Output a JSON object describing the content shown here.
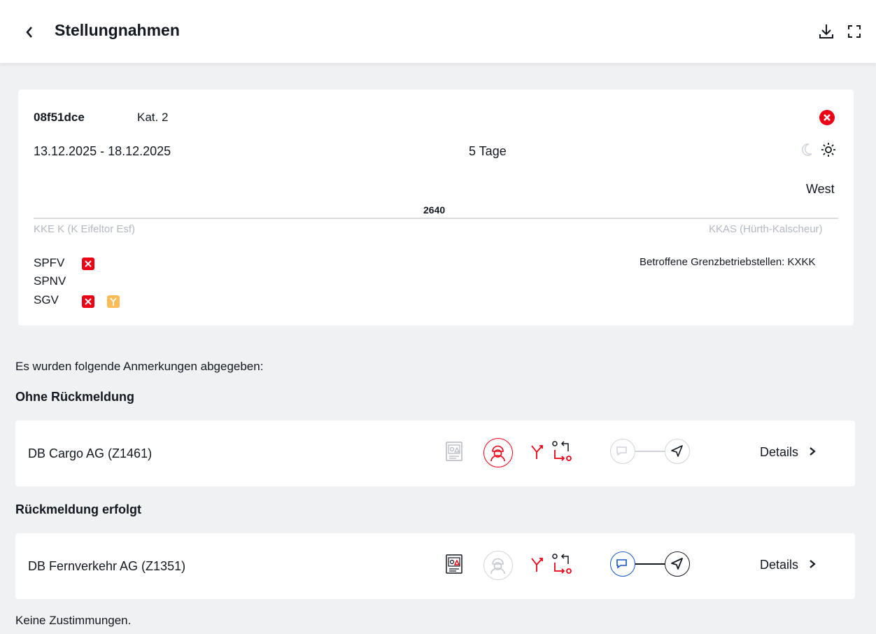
{
  "header": {
    "title": "Stellungnahmen",
    "back_icon": "chevron-left-icon",
    "download_icon": "download-icon",
    "fullscreen_icon": "fullscreen-icon"
  },
  "measure": {
    "id": "08f51dce",
    "category": "Kat. 2",
    "date_range": "13.12.2025 - 18.12.2025",
    "duration": "5 Tage",
    "direction": "West",
    "track_km": "2640",
    "station_start": "KKE K (K Eifeltor Esf)",
    "station_end": "KKAS (Hürth-Kalscheur)",
    "traffic_types": [
      {
        "label": "SPFV"
      },
      {
        "label": "SPNV"
      },
      {
        "label": "SGV"
      }
    ],
    "border_stations": "Betroffene Grenzbetriebstellen: KXKK"
  },
  "intro_text": "Es wurden folgende Anmerkungen abgegeben:",
  "sections": [
    {
      "heading": "Ohne Rückmeldung",
      "row_name": "DB Cargo AG (Z1461)",
      "details_label": "Details"
    },
    {
      "heading": "Rückmeldung erfolgt",
      "row_name": "DB Fernverkehr AG (Z1351)",
      "details_label": "Details"
    }
  ],
  "footer_text": "Keine Zustimmungen.",
  "colors": {
    "accent_red": "#ec0016",
    "warning_orange": "#ffbb56",
    "feedback_blue": "#1455c0",
    "background": "#f0f1f3"
  }
}
